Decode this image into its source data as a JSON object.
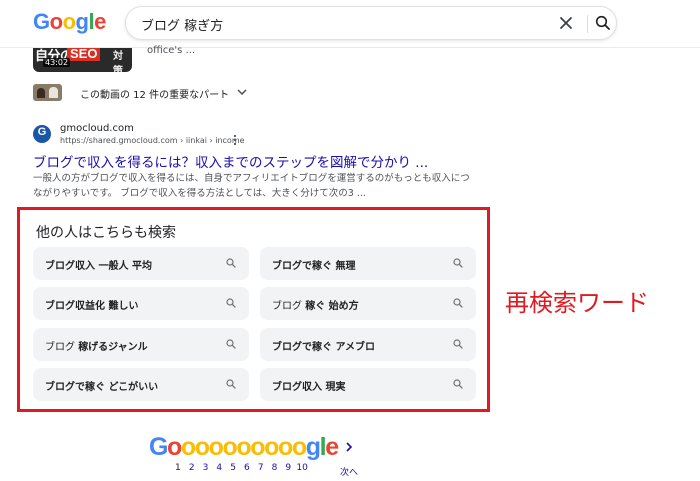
{
  "header": {
    "logo_letters": [
      {
        "ch": "G",
        "color": "#4285f4"
      },
      {
        "ch": "o",
        "color": "#ea4335"
      },
      {
        "ch": "o",
        "color": "#fbbc05"
      },
      {
        "ch": "g",
        "color": "#4285f4"
      },
      {
        "ch": "l",
        "color": "#34a853"
      },
      {
        "ch": "e",
        "color": "#ea4335"
      }
    ],
    "search_query": "ブログ 稼ぎ方",
    "clear_icon": "close-icon",
    "search_icon": "search-icon"
  },
  "video_result": {
    "thumb_title": "自分の",
    "thumb_seo": "SEO",
    "thumb_sub": "対策",
    "duration": "43:02",
    "meta": "office's ...",
    "moments_label": "この動画の 12 件の重要なパート",
    "moments_icon": "chevron-down-icon"
  },
  "web_result": {
    "site_initial": "G",
    "site_name": "gmocloud.com",
    "site_url": "https://shared.gmocloud.com › iinkai › income",
    "title": "ブログで収入を得るには？収入までのステップを図解で分かり ...",
    "snippet": "一般人の方がブログで収入を得るには、自身でアフィリエイトブログを運営するのがもっとも収入につながりやすいです。 ブログで収入を得る方法としては、大きく分けて次の3 ..."
  },
  "related": {
    "heading": "他の人はこちらも検索",
    "chips": [
      {
        "light": "",
        "bold": "ブログ収入 一般人 平均"
      },
      {
        "light": "",
        "bold": "ブログで稼ぐ 無理"
      },
      {
        "light": "",
        "bold": "ブログ収益化 難しい"
      },
      {
        "light": "ブログ ",
        "bold": "稼ぐ 始め方"
      },
      {
        "light": "ブログ ",
        "bold": "稼げるジャンル"
      },
      {
        "light": "",
        "bold": "ブログで稼ぐ アメブロ"
      },
      {
        "light": "",
        "bold": "ブログで稼ぐ どこがいい"
      },
      {
        "light": "",
        "bold": "ブログ収入 現実"
      }
    ]
  },
  "annotation": "再検索ワード",
  "pagination": {
    "logo_letters": [
      {
        "ch": "G",
        "color": "#4285f4"
      },
      {
        "ch": "o",
        "color": "#ea4335"
      },
      {
        "ch": "o",
        "color": "#fbbc05"
      },
      {
        "ch": "o",
        "color": "#fbbc05"
      },
      {
        "ch": "o",
        "color": "#fbbc05"
      },
      {
        "ch": "o",
        "color": "#fbbc05"
      },
      {
        "ch": "o",
        "color": "#fbbc05"
      },
      {
        "ch": "o",
        "color": "#fbbc05"
      },
      {
        "ch": "o",
        "color": "#fbbc05"
      },
      {
        "ch": "o",
        "color": "#fbbc05"
      },
      {
        "ch": "o",
        "color": "#fbbc05"
      },
      {
        "ch": "g",
        "color": "#4285f4"
      },
      {
        "ch": "l",
        "color": "#34a853"
      },
      {
        "ch": "e",
        "color": "#ea4335"
      }
    ],
    "pages": [
      "1",
      "2",
      "3",
      "4",
      "5",
      "6",
      "7",
      "8",
      "9",
      "10"
    ],
    "current_page": "1",
    "next_label": "次へ"
  }
}
